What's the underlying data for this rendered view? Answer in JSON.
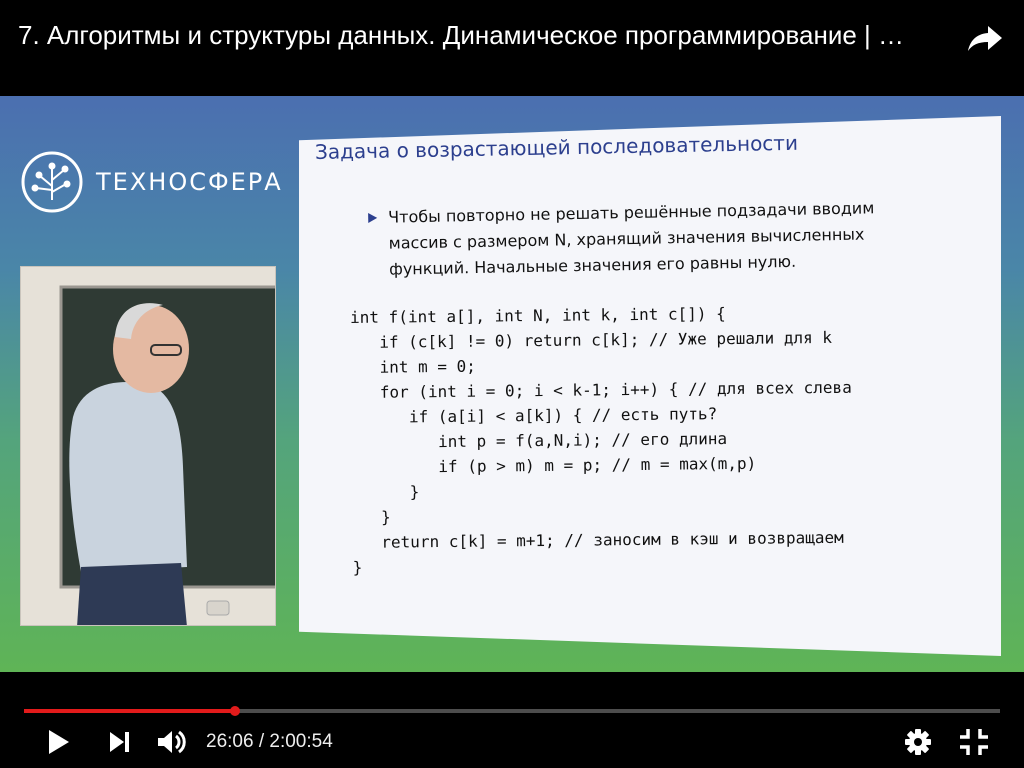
{
  "video": {
    "title": "7. Алгоритмы и структуры данных. Динамическое программирование | …"
  },
  "icons": {
    "share": "share-arrow-icon",
    "play": "play-icon",
    "next": "next-icon",
    "volume": "volume-icon",
    "settings": "gear-icon",
    "exit_fullscreen": "exit-fullscreen-icon"
  },
  "player": {
    "current_time": "26:06",
    "separator": " / ",
    "duration": "2:00:54",
    "progress_fraction": 0.216,
    "accent_color": "#e21b1b"
  },
  "logo": {
    "text": "ТЕХНОСФЕРА"
  },
  "slide": {
    "title": "Задача о возрастающей последовательности",
    "bullet_lines": [
      "Чтобы повторно не решать решённые подзадачи вводим",
      "массив c размером N, хранящий значения вычисленных",
      "функций. Начальные значения его равны нулю."
    ],
    "code_lines": [
      "int f(int a[], int N, int k, int c[]) {",
      "   if (c[k] != 0) return c[k]; // Уже решали для k",
      "   int m = 0;",
      "   for (int i = 0; i < k-1; i++) { // для всех слева",
      "      if (a[i] < a[k]) { // есть путь?",
      "         int p = f(a,N,i); // его длина",
      "         if (p > m) m = p; // m = max(m,p)",
      "      }",
      "   }",
      "   return c[k] = m+1; // заносим в кэш и возвращаем",
      "}"
    ]
  }
}
